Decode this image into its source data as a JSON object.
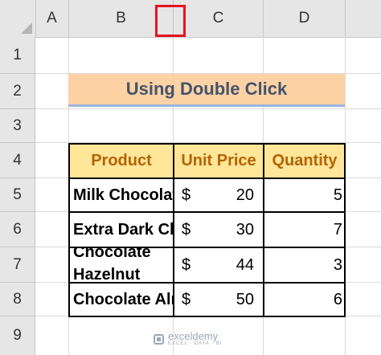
{
  "columns": [
    "A",
    "B",
    "C",
    "D"
  ],
  "rows": [
    "1",
    "2",
    "3",
    "4",
    "5",
    "6",
    "7",
    "8",
    "9"
  ],
  "title": "Using Double Click",
  "table": {
    "headers": [
      "Product",
      "Unit Price",
      "Quantity"
    ],
    "rows": [
      {
        "product": "Milk Chocolate",
        "currency": "$",
        "price": "20",
        "quantity": "5"
      },
      {
        "product": "Extra Dark Chocolate",
        "currency": "$",
        "price": "30",
        "quantity": "7"
      },
      {
        "product": "Chocolate Hazelnut",
        "currency": "$",
        "price": "44",
        "quantity": "3"
      },
      {
        "product": "Chocolate Almond",
        "currency": "$",
        "price": "50",
        "quantity": "6"
      }
    ]
  },
  "watermark": {
    "name": "exceldemy",
    "tagline": "EXCEL · DATA · BI"
  },
  "colors": {
    "highlight": "#e8131e",
    "title_fill": "#fdd2a5",
    "header_fill": "#ffe699",
    "header_text": "#b46304"
  }
}
